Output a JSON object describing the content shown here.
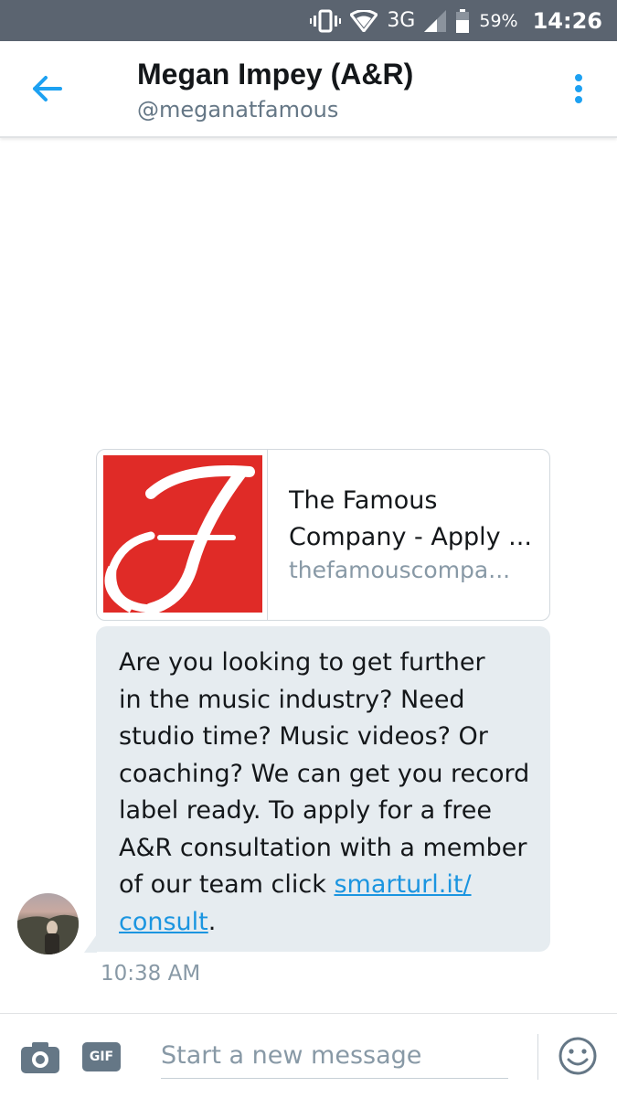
{
  "status_bar": {
    "network": "3G",
    "battery": "59%",
    "time": "14:26"
  },
  "header": {
    "name": "Megan Impey (A&R)",
    "handle": "@meganatfamous",
    "back_icon": "arrow-left-icon",
    "menu_icon": "more-vertical-icon"
  },
  "card": {
    "title_lines": [
      "The Famous",
      "Company - Apply ..."
    ],
    "url": "thefamouscompa...",
    "logo_letter": "F"
  },
  "message": {
    "lines": [
      "Are you looking to get further",
      "in the music industry? Need",
      "studio time? Music videos? Or",
      "coaching? We can get you record",
      "label ready. To apply for a free",
      "A&R consultation with a member"
    ],
    "line7_prefix": "of our team click ",
    "link_part1": "smarturl.it/",
    "link_part2": "consult",
    "line8_suffix": ".",
    "timestamp": "10:38 AM"
  },
  "composer": {
    "camera_icon": "camera-icon",
    "gif_label": "GIF",
    "placeholder": "Start a new message",
    "emoji_icon": "emoji-icon"
  },
  "colors": {
    "accent": "#1da1f2",
    "link": "#1b95e0",
    "bubble": "#e6ecf0",
    "status_bar": "#5b6470",
    "logo_red": "#e02b27"
  }
}
